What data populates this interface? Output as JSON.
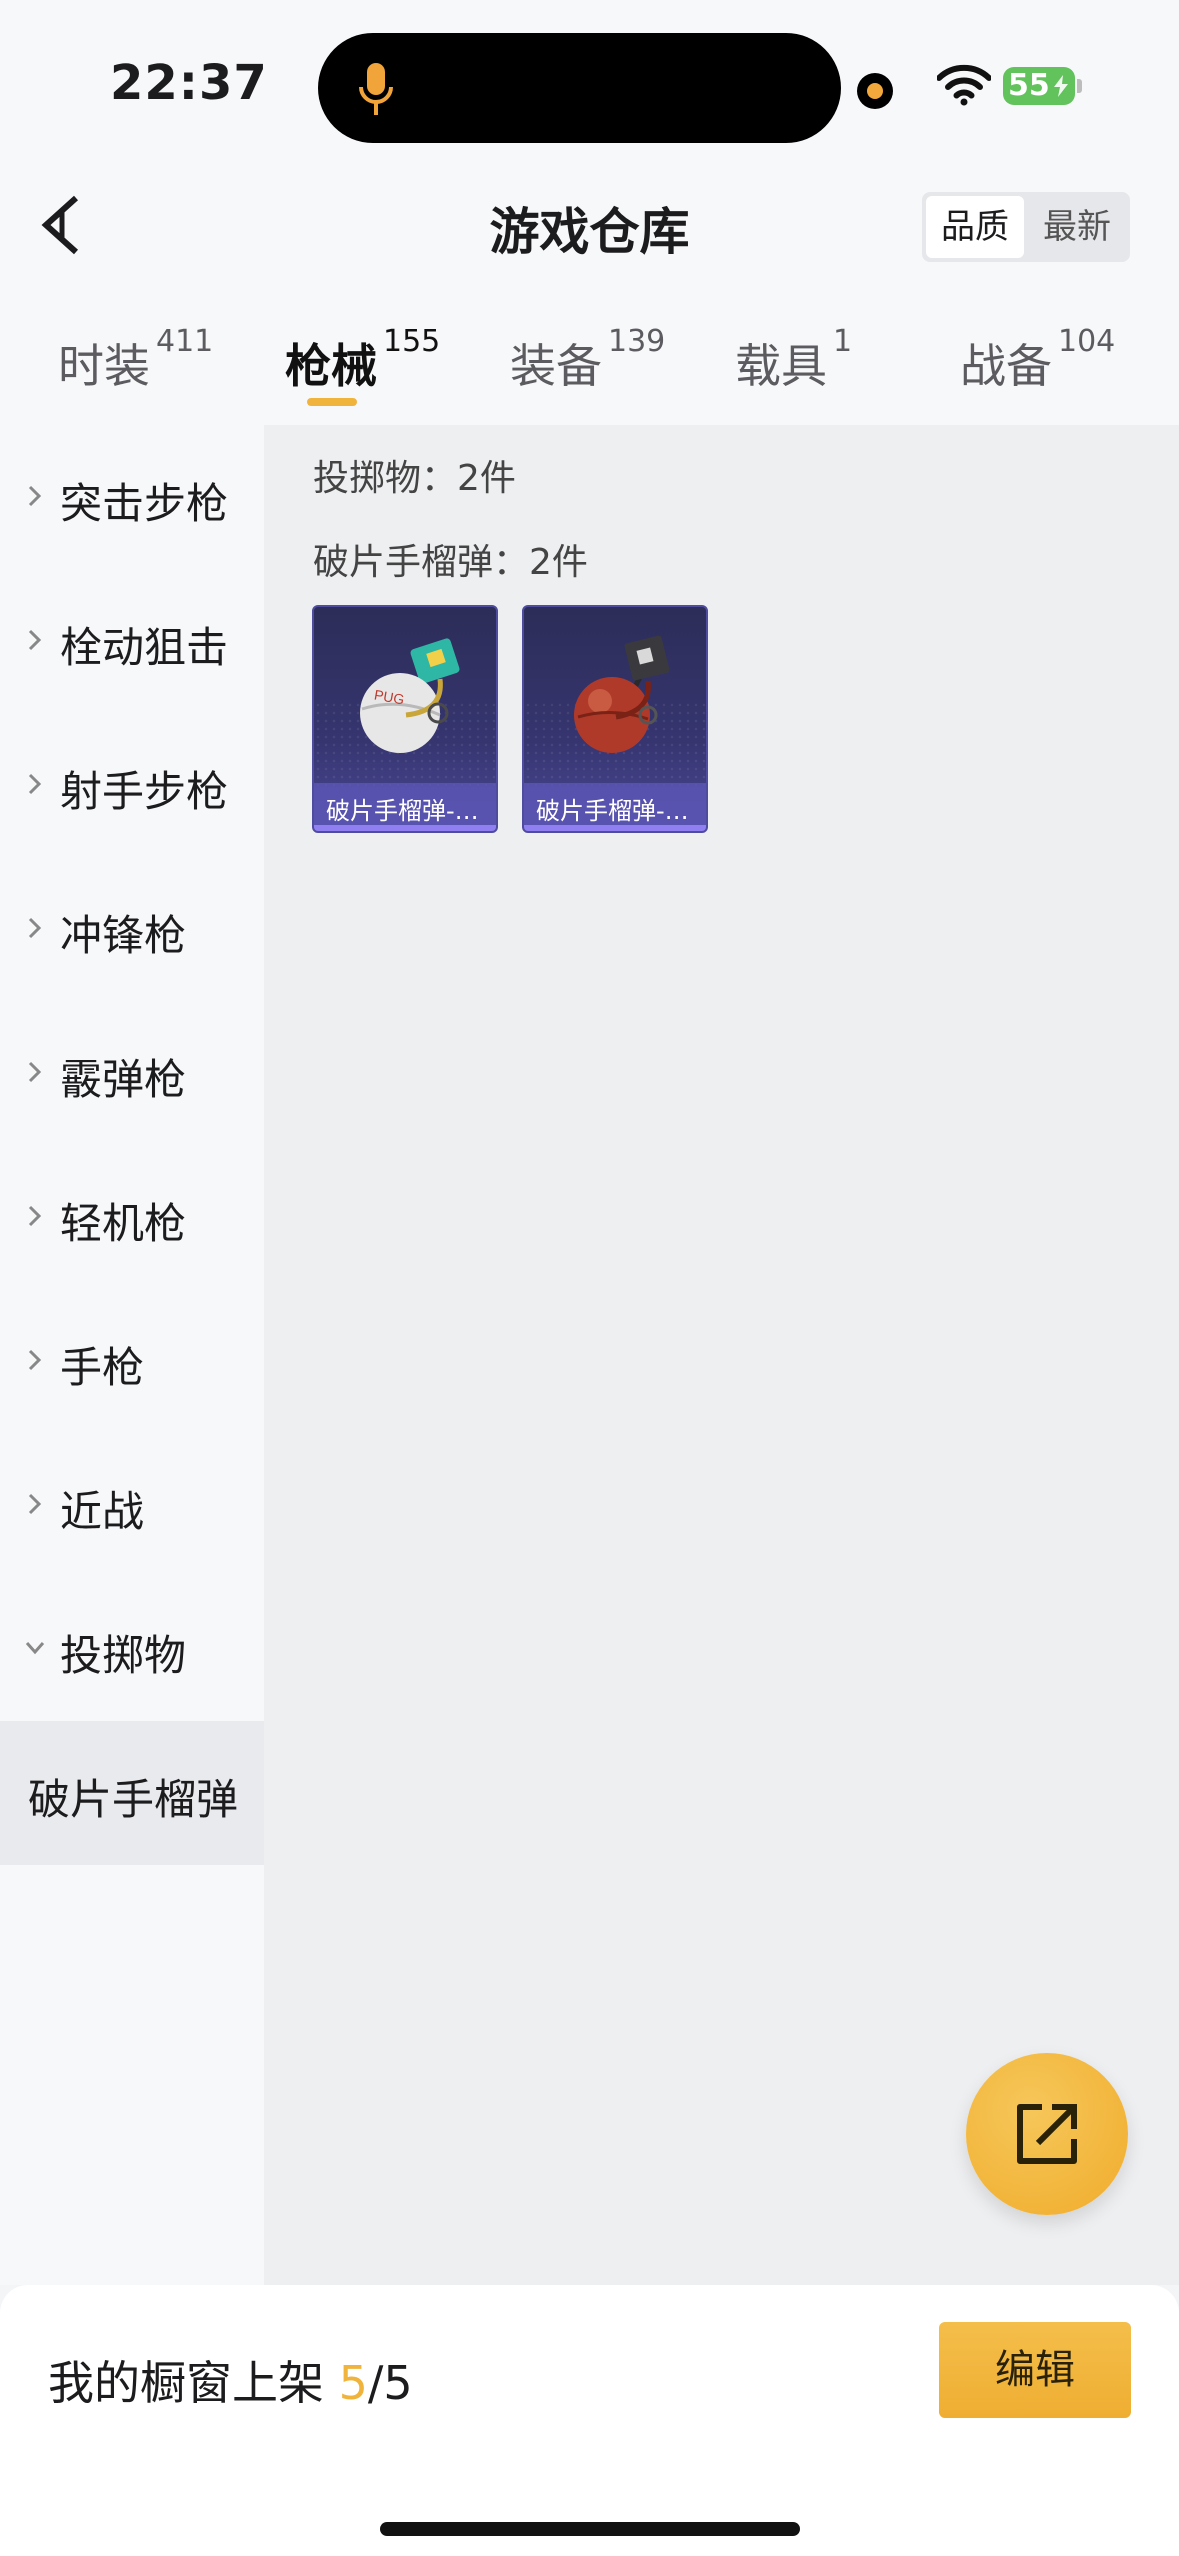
{
  "status_bar": {
    "time": "22:37",
    "battery": "55"
  },
  "header": {
    "title": "游戏仓库",
    "sort_options": [
      "品质",
      "最新"
    ]
  },
  "tabs": [
    {
      "label": "时装",
      "count": "411"
    },
    {
      "label": "枪械",
      "count": "155"
    },
    {
      "label": "装备",
      "count": "139"
    },
    {
      "label": "载具",
      "count": "1"
    },
    {
      "label": "战备",
      "count": "104"
    }
  ],
  "sidebar": {
    "items": [
      {
        "label": "突击步枪"
      },
      {
        "label": "栓动狙击"
      },
      {
        "label": "射手步枪"
      },
      {
        "label": "冲锋枪"
      },
      {
        "label": "霰弹枪"
      },
      {
        "label": "轻机枪"
      },
      {
        "label": "手枪"
      },
      {
        "label": "近战"
      },
      {
        "label": "投掷物"
      },
      {
        "label": "破片手榴弹"
      }
    ]
  },
  "content": {
    "category_line": "投掷物：2件",
    "subcategory_line": "破片手榴弹：2件",
    "items": [
      {
        "name": "破片手榴弹-…"
      },
      {
        "name": "破片手榴弹-…"
      }
    ]
  },
  "bottom_bar": {
    "shelf_label": "我的橱窗上架",
    "shelf_current": "5",
    "shelf_total": "/5",
    "edit_label": "编辑"
  },
  "colors": {
    "accent": "#f0b43d",
    "card_bg": "#2c2d58",
    "battery": "#62c25b"
  }
}
